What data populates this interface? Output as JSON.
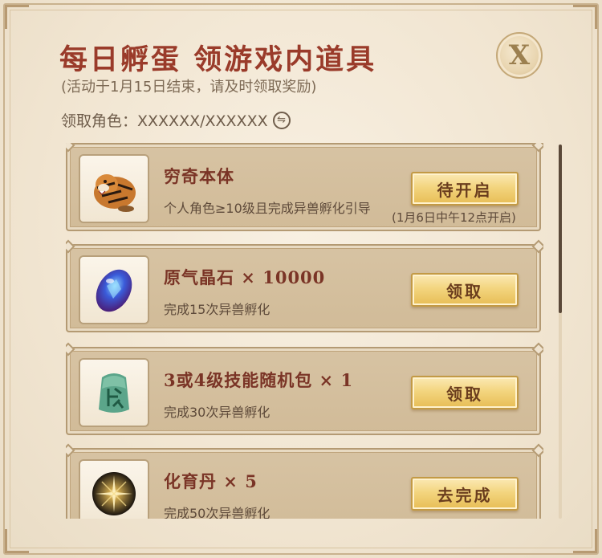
{
  "header": {
    "title": "每日孵蛋 领游戏内道具",
    "subtitle": "(活动于1月15日结束，请及时领取奖励)",
    "role_label": "领取角色：XXXXXX/XXXXXX",
    "close_glyph": "X"
  },
  "rewards": [
    {
      "name": "穷奇本体",
      "desc": "个人角色≥10级且完成异兽孵化引导",
      "button": "待开启",
      "note": "(1月6日中午12点开启)",
      "icon": "tiger-icon"
    },
    {
      "name": "原气晶石 × 10000",
      "desc": "完成15次异兽孵化",
      "button": "领取",
      "icon": "crystal-icon"
    },
    {
      "name": "3或4级技能随机包 × 1",
      "desc": "完成30次异兽孵化",
      "button": "领取",
      "icon": "jade-seal-icon"
    },
    {
      "name": "化育丹 × 5",
      "desc": "完成50次异兽孵化",
      "button": "去完成",
      "icon": "pill-icon"
    }
  ],
  "colors": {
    "title": "#9a3b2a",
    "card": "#d4bf9d",
    "button": "#f3d57f"
  }
}
